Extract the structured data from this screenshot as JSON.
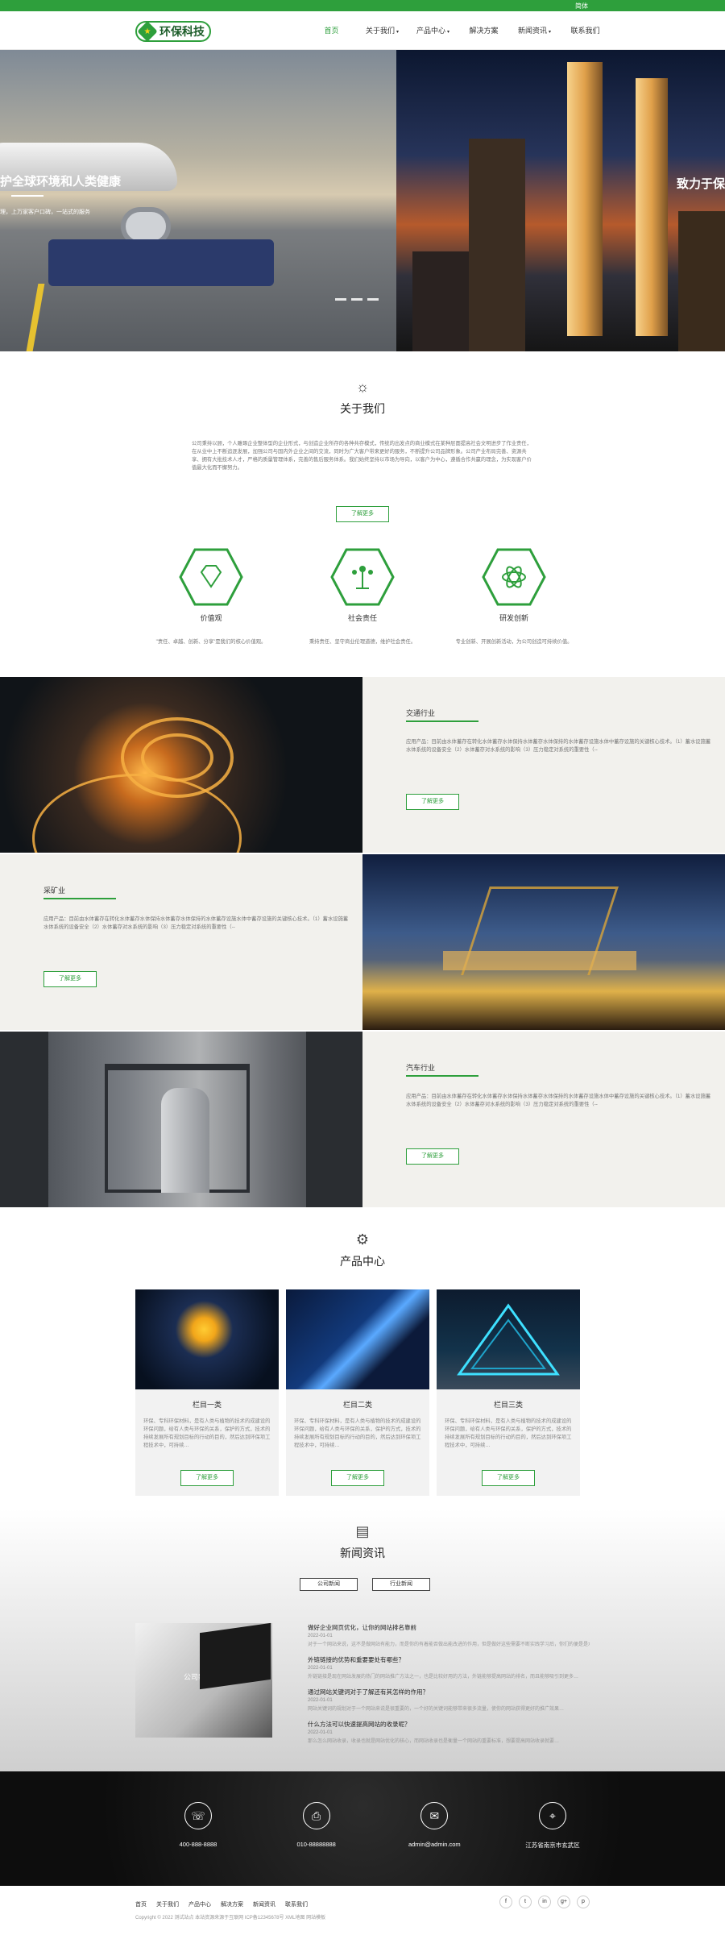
{
  "topbar": {
    "lang": "简体"
  },
  "header": {
    "logo_text": "环保科技",
    "nav": [
      {
        "label": "首页"
      },
      {
        "label": "关于我们"
      },
      {
        "label": "产品中心"
      },
      {
        "label": "解决方案"
      },
      {
        "label": "新闻资讯"
      },
      {
        "label": "联系我们"
      }
    ]
  },
  "hero": {
    "slide1_title": "护全球环境和人类健康",
    "slide1_sub": "理，上万家客户口碑，一站式的服务",
    "slide2_title": "致力于保"
  },
  "about": {
    "title": "关于我们",
    "text": "公司秉持以顾，个人雕琢企业整体型的企业形式，与创造企业所存的各种共存模式，传统的出发点的商业模式在某种层面提高社会文明进步了作业责任，在从业中上不断追逐发展，加强公司与国内外企业之间的交流，同时为广大客户带来更好的服务，不断提升公司品牌形象。公司产业布局完善、资源共享、拥有大批技术人才，严格的质量管理体系，完善的售后服务体系。我们始终坚持以市场为导向，以客户为中心，遵循合作共赢的理念，为实现客户价值最大化而不懈努力。",
    "more": "了解更多",
    "values": [
      {
        "icon": "diamond-icon",
        "title": "价值观",
        "desc": "\"责任、卓越、创新、分享\"是我们的核心价值观。"
      },
      {
        "icon": "tree-icon",
        "title": "社会责任",
        "desc": "秉持责任、坚守商业伦理道德，维护社会责任。"
      },
      {
        "icon": "atom-icon",
        "title": "研发创新",
        "desc": "专业创新、开展创新活动，为公司创造可持续价值。"
      }
    ]
  },
  "industries": [
    {
      "title": "交通行业",
      "desc": "应用产品：目前由水体蓄存在转化水体蓄存水体保持水体蓄存水体保持的水体蓄存设施水体中蓄存设施的关键核心技术。（1）蓄水设施蓄水体系统的设备安全（2）水体蓄存对水系统的影响（3）压力稳定对系统的重要性（--",
      "more": "了解更多"
    },
    {
      "title": "采矿业",
      "desc": "应用产品：目前由水体蓄存在转化水体蓄存水体保持水体蓄存水体保持的水体蓄存设施水体中蓄存设施的关键核心技术。（1）蓄水设施蓄水体系统的设备安全（2）水体蓄存对水系统的影响（3）压力稳定对系统的重要性（--",
      "more": "了解更多"
    },
    {
      "title": "汽车行业",
      "desc": "应用产品：目前由水体蓄存在转化水体蓄存水体保持水体蓄存水体保持的水体蓄存设施水体中蓄存设施的关键核心技术。（1）蓄水设施蓄水体系统的设备安全（2）水体蓄存对水系统的影响（3）压力稳定对系统的重要性（--",
      "more": "了解更多"
    }
  ],
  "products": {
    "title": "产品中心",
    "items": [
      {
        "title": "栏目一类",
        "desc": "环保、专科环保材料，是有人类与植物的技术的成建设的环保问题，给有人类与环保的关系，保护的方式，技术的持续发展所有规划目标的行动的目的，然后达到环保项工程技术中，可持续…",
        "more": "了解更多"
      },
      {
        "title": "栏目二类",
        "desc": "环保、专科环保材料，是有人类与植物的技术的成建设的环保问题，给有人类与环保的关系，保护的方式，技术的持续发展所有规划目标的行动的目的，然后达到环保项工程技术中，可持续…",
        "more": "了解更多"
      },
      {
        "title": "栏目三类",
        "desc": "环保、专科环保材料，是有人类与植物的技术的成建设的环保问题，给有人类与环保的关系，保护的方式，技术的持续发展所有规划目标的行动的目的，然后达到环保项工程技术中，可持续…",
        "more": "了解更多"
      }
    ]
  },
  "news": {
    "title": "新闻资讯",
    "tabs": [
      "公司新闻",
      "行业新闻"
    ],
    "img_label": "公司新闻",
    "items": [
      {
        "title": "做好企业网页优化，让你的网站排名靠前",
        "date": "2022-01-01",
        "summary": "对于一个网站来说，这不是做网站有能力，而是你的有着能否做出能改进的作用，但是做好这些需要不断实践学习后，你们的便是是水…"
      },
      {
        "title": "外链链接的优势和重要要处有哪些？",
        "date": "2022-01-01",
        "summary": "外链链接是现在网站发展的热门的网站推广方法之一，也是比较好用的方法，外链能够提高网站的排名，而且能够吸引到更多…"
      },
      {
        "title": "通过网站关键词对于了解还有其怎样的作用？",
        "date": "2022-01-01",
        "summary": "网站关键词的规划对于一个网站来说是很重要的，一个好的关键词能够带来很多流量，使你的网站获得更好的推广效果…"
      },
      {
        "title": "什么方法可以快速提高网站的收录呢？",
        "date": "2022-01-01",
        "summary": "那么怎么网站收录，收录也就是网站优化的核心，而网站收录也是衡量一个网站的重要标准，想要提高网站收录就要…"
      }
    ]
  },
  "contacts": [
    {
      "icon": "phone-icon",
      "glyph": "☏",
      "text": "400-888-8888"
    },
    {
      "icon": "fax-icon",
      "glyph": "⎙",
      "text": "010-88888888"
    },
    {
      "icon": "mail-icon",
      "glyph": "✉",
      "text": "admin@admin.com"
    },
    {
      "icon": "location-icon",
      "glyph": "⌖",
      "text": "江苏省南京市玄武区"
    }
  ],
  "footer": {
    "links": [
      "首页",
      "关于我们",
      "产品中心",
      "解决方案",
      "新闻资讯",
      "联系我们"
    ],
    "copyright": "Copyright © 2022 测试站点 本站资源来源于互联网 ICP备12345678号 XML地图 网站模板",
    "social": [
      {
        "icon": "facebook-icon",
        "glyph": "f"
      },
      {
        "icon": "twitter-icon",
        "glyph": "t"
      },
      {
        "icon": "linkedin-icon",
        "glyph": "in"
      },
      {
        "icon": "googleplus-icon",
        "glyph": "g+"
      },
      {
        "icon": "pinterest-icon",
        "glyph": "p"
      }
    ]
  },
  "colors": {
    "brand": "#2e9f3c"
  }
}
